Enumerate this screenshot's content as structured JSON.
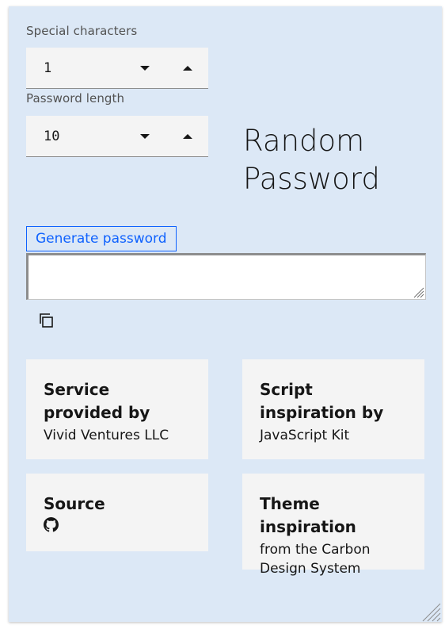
{
  "form": {
    "special_chars": {
      "label": "Special characters",
      "value": "1"
    },
    "password_length": {
      "label": "Password length",
      "value": "10"
    }
  },
  "title": {
    "line1": "Random",
    "line2": "Password"
  },
  "generate_button": "Generate password",
  "output": {
    "value": ""
  },
  "cards": {
    "service": {
      "title": "Service provided by",
      "body": "Vivid Ventures LLC"
    },
    "script": {
      "title": "Script inspiration by",
      "body": "JavaScript Kit"
    },
    "source": {
      "title": "Source",
      "icon": "github-icon"
    },
    "theme": {
      "title": "Theme inspiration",
      "body": "from the Carbon Design System"
    }
  },
  "colors": {
    "panel_bg": "#dce8f6",
    "card_bg": "#f4f4f4",
    "accent": "#0f62fe",
    "text": "#161616"
  }
}
